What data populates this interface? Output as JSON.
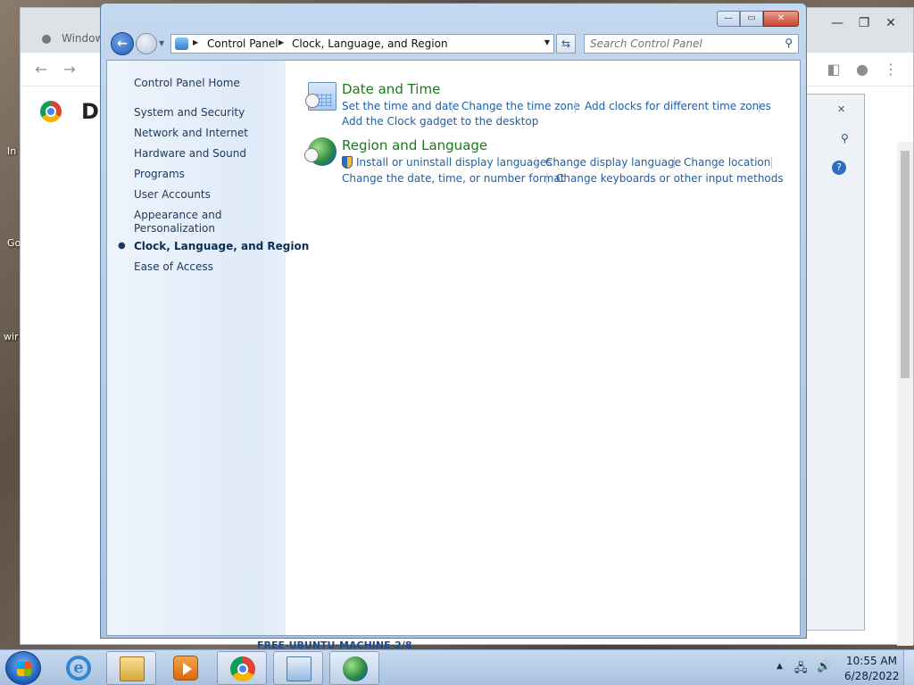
{
  "desktop": {
    "labels": [
      "In",
      "Go",
      "wir"
    ]
  },
  "chrome": {
    "tab_title": "Window",
    "page_title_fragment": "Do",
    "bottom_text": "FREE-UBUNTU-MACHINE-2/8"
  },
  "window": {
    "breadcrumb": [
      "Control Panel",
      "Clock, Language, and Region"
    ],
    "search_placeholder": "Search Control Panel",
    "caption_buttons": {
      "minimize": "—",
      "maximize": "▭",
      "close": "✕"
    }
  },
  "sidebar": {
    "home": "Control Panel Home",
    "items": [
      "System and Security",
      "Network and Internet",
      "Hardware and Sound",
      "Programs",
      "User Accounts",
      "Appearance and",
      "Personalization",
      "Clock, Language, and Region",
      "Ease of Access"
    ],
    "active_index": 7
  },
  "categories": [
    {
      "title": "Date and Time",
      "icon": "calendar-clock-icon",
      "links": [
        "Set the time and date",
        "Change the time zone",
        "Add clocks for different time zones",
        "Add the Clock gadget to the desktop"
      ]
    },
    {
      "title": "Region and Language",
      "icon": "globe-clock-icon",
      "links": [
        "Install or uninstall display languages",
        "Change display language",
        "Change location",
        "Change the date, time, or number format",
        "Change keyboards or other input methods"
      ]
    }
  ],
  "taskbar": {
    "apps": [
      "internet-explorer-icon",
      "folder-icon",
      "media-player-icon",
      "chrome-icon",
      "remote-desktop-icon",
      "control-panel-icon"
    ],
    "tray_icons": [
      "show-hidden-icons",
      "network-icon",
      "volume-icon"
    ],
    "time": "10:55 AM",
    "date": "6/28/2022"
  }
}
